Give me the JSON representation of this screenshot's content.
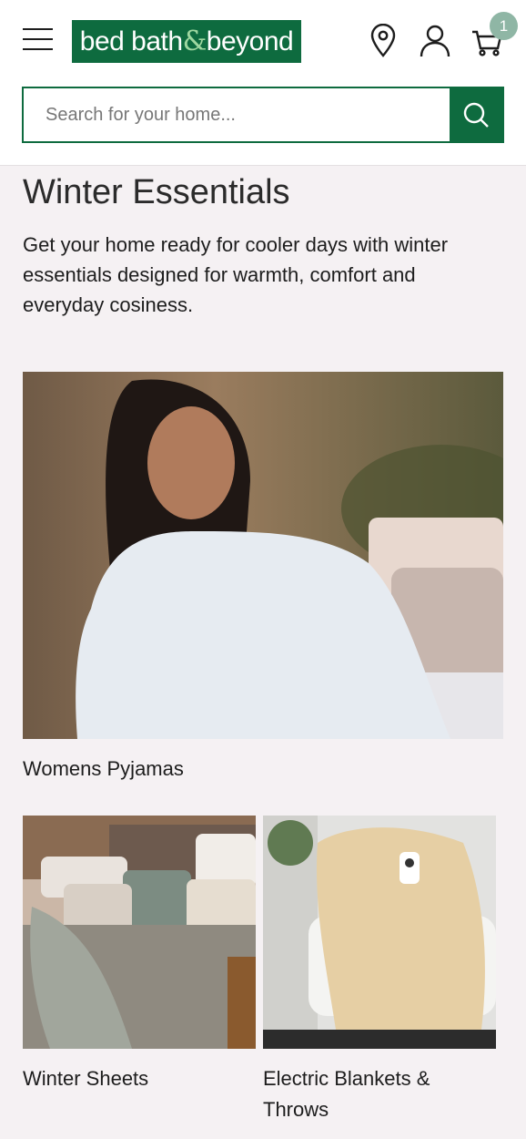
{
  "header": {
    "logo": {
      "part1": "bed bath",
      "amp": "&",
      "part2": "beyond"
    },
    "cart_count": "1",
    "search": {
      "placeholder": "Search for your home..."
    }
  },
  "main": {
    "title": "Winter Essentials",
    "description": "Get your home ready for cooler days with winter essentials designed for warmth, comfort and everyday cosiness.",
    "cards": [
      {
        "label": "Womens Pyjamas"
      },
      {
        "label": "Winter Sheets"
      },
      {
        "label": "Electric Blankets & Throws"
      }
    ]
  },
  "colors": {
    "brand": "#0e6b3f",
    "badge": "#8fb6a5",
    "background": "#f5f1f3"
  }
}
